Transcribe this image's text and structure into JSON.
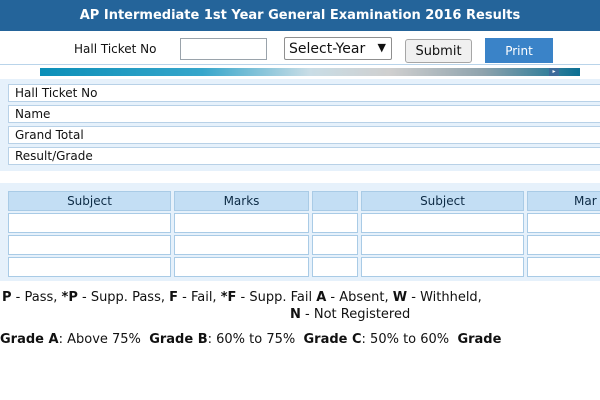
{
  "title": "AP Intermediate 1st Year General Examination 2016 Results",
  "form": {
    "hall_ticket_label": "Hall Ticket No",
    "hall_ticket_value": "",
    "year_select": "Select-Year",
    "submit_label": "Submit",
    "print_label": "Print"
  },
  "info": {
    "rows": [
      "Hall Ticket No",
      "Name",
      "Grand Total",
      "Result/Grade"
    ]
  },
  "marks": {
    "headers": [
      "Subject",
      "Marks",
      "",
      "Subject",
      "Mar"
    ]
  },
  "legend": {
    "items": [
      {
        "code": "P",
        "text": " - Pass, "
      },
      {
        "code": "*P",
        "text": " - Supp. Pass, "
      },
      {
        "code": "F",
        "text": " - Fail, "
      },
      {
        "code": "*F",
        "text": " - Supp. Fail "
      },
      {
        "code": "A",
        "text": " - Absent, "
      },
      {
        "code": "W",
        "text": " - Withheld, "
      }
    ],
    "line2_code": "N",
    "line2_text": " - Not Registered"
  },
  "grades": [
    {
      "code": "Grade A",
      "text": ": Above 75%"
    },
    {
      "code": "Grade B",
      "text": ": 60% to 75%"
    },
    {
      "code": "Grade C",
      "text": ": 50% to 60%"
    },
    {
      "code": "Grade",
      "text": ""
    }
  ],
  "colors": {
    "title_bg": "#24649a",
    "print_bg": "#3a83c8",
    "header_cell_bg": "#c3def4",
    "panel_bg": "#e6f1fb"
  }
}
